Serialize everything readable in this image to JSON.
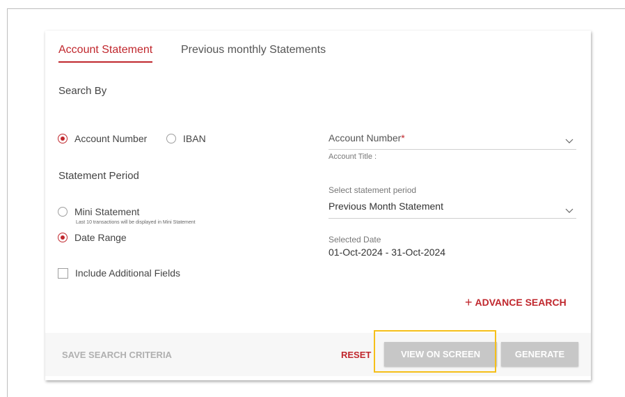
{
  "tabs": {
    "account_statement": "Account Statement",
    "previous_monthly": "Previous monthly Statements"
  },
  "search_by": {
    "heading": "Search By",
    "options": [
      {
        "label": "Account Number",
        "checked": true
      },
      {
        "label": "IBAN",
        "checked": false
      }
    ]
  },
  "statement_period": {
    "heading": "Statement Period",
    "options": [
      {
        "label": "Mini Statement",
        "hint": "Last 10 transactions will be displayed in Mini Statement",
        "checked": false
      },
      {
        "label": "Date Range",
        "checked": true
      }
    ]
  },
  "include_fields": {
    "label": "Include Additional Fields",
    "checked": false
  },
  "account_field": {
    "label": "Account Number",
    "required_mark": "*",
    "title_label": "Account Title :"
  },
  "period_field": {
    "label": "Select statement period",
    "value": "Previous Month Statement"
  },
  "selected_date": {
    "label": "Selected Date",
    "value": "01-Oct-2024 - 31-Oct-2024"
  },
  "advance_search": {
    "plus": "+",
    "label": "ADVANCE SEARCH"
  },
  "footer": {
    "save_criteria": "SAVE SEARCH CRITERIA",
    "reset": "RESET",
    "view_on_screen": "VIEW ON SCREEN",
    "generate": "GENERATE"
  },
  "colors": {
    "accent": "#c0272d",
    "disabled_button": "#c7c7c7",
    "highlight": "#f5bf19"
  },
  "icons": [
    "chevron-down-icon",
    "plus-icon"
  ]
}
